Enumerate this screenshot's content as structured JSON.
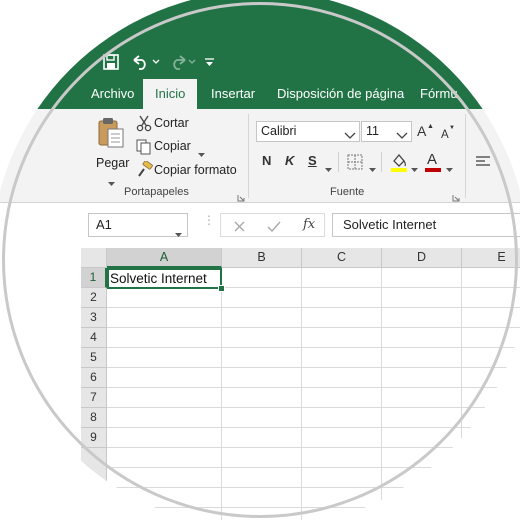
{
  "colors": {
    "accent": "#217346",
    "ribbon_bg": "#f3f3f3",
    "font_color_underline": "#c00000",
    "fill_color_underline": "#ffff00"
  },
  "quick_access": {
    "save_icon": "save-icon",
    "undo_icon": "undo-icon",
    "redo_icon": "redo-icon",
    "customize_icon": "customize-qat-icon"
  },
  "tabs": [
    {
      "label": "Archivo"
    },
    {
      "label": "Inicio",
      "active": true
    },
    {
      "label": "Insertar"
    },
    {
      "label": "Disposición de página"
    },
    {
      "label": "Fórmu"
    }
  ],
  "ribbon": {
    "portapapeles": {
      "paste_label": "Pegar",
      "cut_label": "Cortar",
      "copy_label": "Copiar",
      "format_painter_label": "Copiar formato",
      "group_label": "Portapapeles"
    },
    "fuente": {
      "font_name": "Calibri",
      "font_size": "11",
      "bold_label": "N",
      "italic_label": "K",
      "underline_label": "S",
      "grow_label": "A",
      "shrink_label": "A",
      "font_color_label": "A",
      "group_label": "Fuente"
    }
  },
  "formula_bar": {
    "name_box": "A1",
    "fx_label": "fx",
    "formula": "Solvetic Internet"
  },
  "sheet": {
    "columns": [
      "A",
      "B",
      "C",
      "D",
      "E"
    ],
    "rows": [
      "1",
      "2",
      "3",
      "4",
      "5",
      "6",
      "7",
      "8",
      "9"
    ],
    "selected_cell": "A1",
    "A1": "Solvetic Internet"
  }
}
